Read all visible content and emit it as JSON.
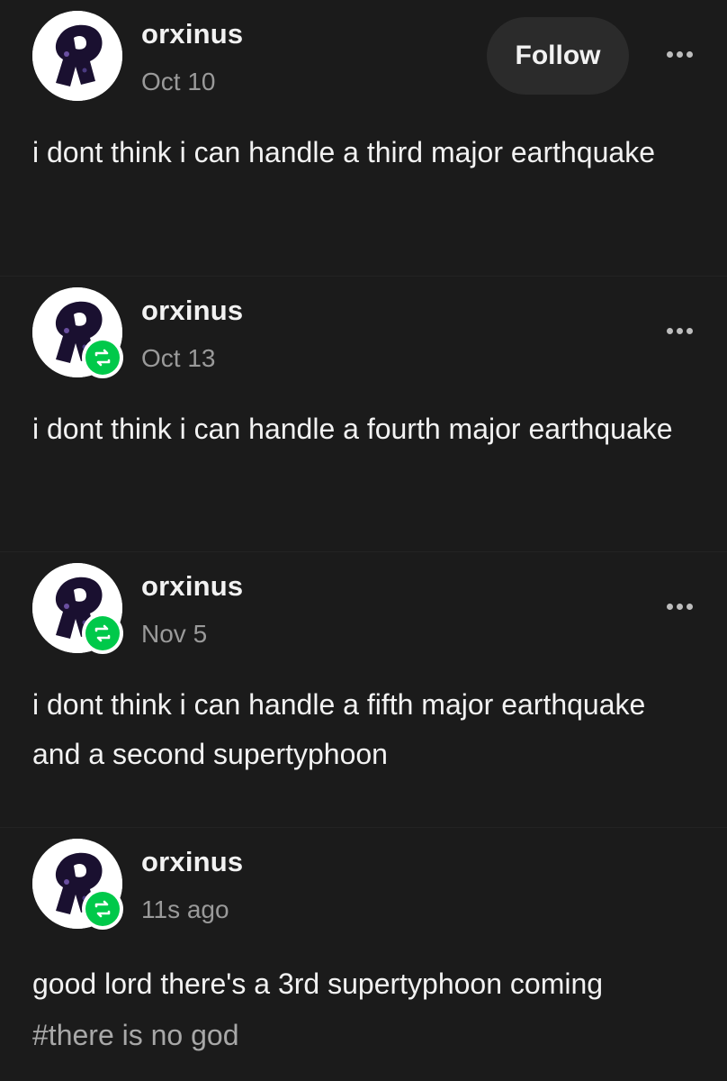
{
  "colors": {
    "background": "#1b1b1b",
    "reblog_badge": "#00c94a",
    "text": "#f2f2f2",
    "muted": "#9a9a9a",
    "follow_button": "#2b2b2b"
  },
  "posts": [
    {
      "username": "orxinus",
      "timestamp": "Oct 10",
      "text": "i dont think i can handle a third major earthquake",
      "follow_label": "Follow",
      "reblog": false,
      "more_icon": "more-horizontal-icon"
    },
    {
      "username": "orxinus",
      "timestamp": "Oct 13",
      "text": "i dont think i can handle a fourth major earthquake",
      "reblog": true,
      "more_icon": "more-horizontal-icon"
    },
    {
      "username": "orxinus",
      "timestamp": "Nov 5",
      "text": "i dont think i can handle a fifth major earthquake and a second supertyphoon",
      "reblog": true,
      "more_icon": "more-horizontal-icon"
    },
    {
      "username": "orxinus",
      "timestamp": "11s ago",
      "text": "good lord there's a 3rd supertyphoon coming",
      "tag": "#there is no god",
      "reblog": true
    }
  ]
}
